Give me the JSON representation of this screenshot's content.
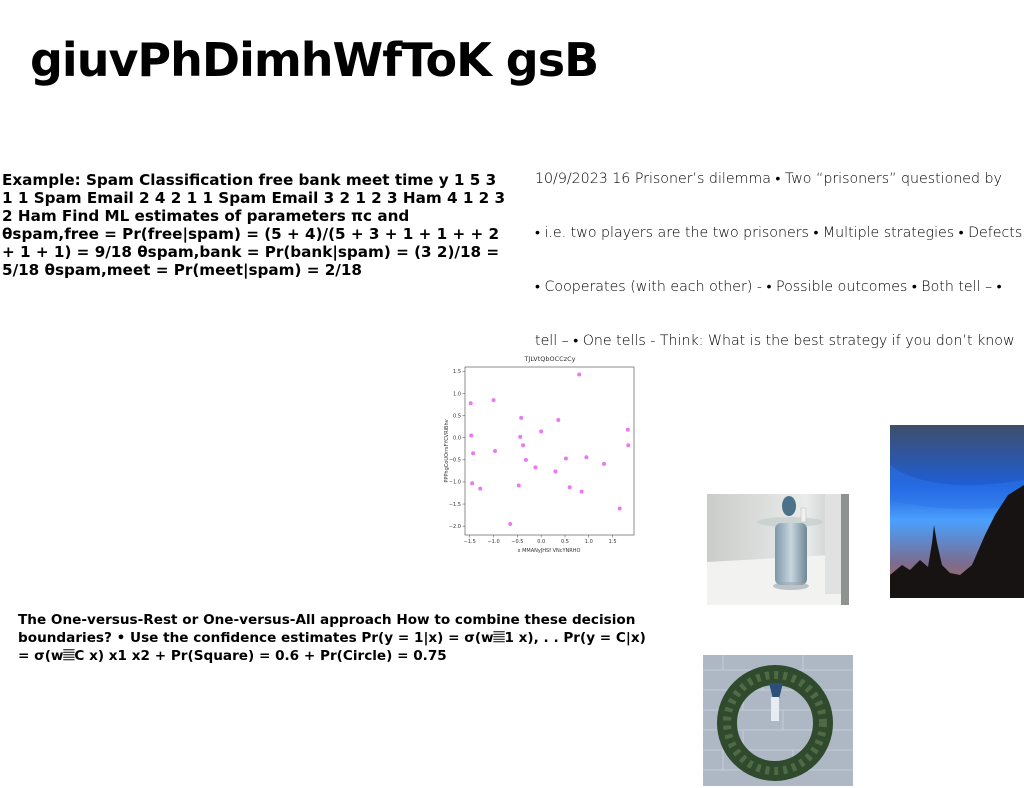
{
  "title": "giuvPhDimhWfToK gsB",
  "spam_text": "Example: Spam Classification free bank meet time y 1 5 3 1 1 Spam Email 2 4 2 1 1 Spam Email 3 2 1 2 3 Ham 4 1 2 3 2 Ham Find ML estimates of parameters πc and θspam,free = Pr(free|spam) = (5 + 4)/(5 + 3 + 1 + 1 + + 2 + 1 + 1) = 9/18 θspam,bank = Pr(bank|spam) = (3 2)/18 = 5/18 θspam,meet = Pr(meet|spam) = 2/18",
  "prisoner_lines": [
    "10/9/2023 16 Prisoner’s dilemma • Two “prisoners” questioned by",
    "• i.e. two players are the two prisoners • Multiple strategies • Defects",
    "• Cooperates (with each other) - • Possible outcomes • Both tell – •",
    "tell – • One tells - Think: What is the best strategy if you don’t know"
  ],
  "ovr_text": "The One-versus-Rest or One-versus-All approach How to combine these decision boundaries? • Use the confidence estimates Pr(y = 1|x) = σ(w𝄚1 x), . . Pr(y = C|x) = σ(w𝄚C x) x1 x2 + Pr(Square) = 0.6 + Pr(Circle) = 0.75",
  "chart_data": {
    "type": "scatter",
    "title": "TJLVtQbOCCzCy",
    "xlabel": "x MMANyJHSf VNcYNRHO",
    "ylabel": "PPPhgCoUOrrsFYCVRIBhv",
    "xlim": [
      -1.6,
      1.95
    ],
    "ylim": [
      -2.2,
      1.6
    ],
    "xticks": [
      -1.5,
      -1.0,
      -0.5,
      0.0,
      0.5,
      1.0,
      1.5
    ],
    "xtick_labels": [
      "−1.5",
      "−1.0",
      "−0.5",
      "0.0",
      "0.5",
      "1.0",
      "1.5"
    ],
    "yticks": [
      1.5,
      1.0,
      0.5,
      0.0,
      -0.5,
      -1.0,
      -1.5,
      -2.0
    ],
    "ytick_labels": [
      "1.5",
      "1.0",
      "0.5",
      "0.0",
      "−0.5",
      "−1.0",
      "−1.5",
      "−2.0"
    ],
    "color": "#e879f0",
    "points": [
      {
        "x": -1.48,
        "y": 0.78
      },
      {
        "x": -1.47,
        "y": 0.05
      },
      {
        "x": -1.43,
        "y": -0.35
      },
      {
        "x": -1.45,
        "y": -1.03
      },
      {
        "x": -1.28,
        "y": -1.15
      },
      {
        "x": -1.0,
        "y": 0.85
      },
      {
        "x": -0.97,
        "y": -0.3
      },
      {
        "x": -0.65,
        "y": -1.95
      },
      {
        "x": -0.47,
        "y": -1.08
      },
      {
        "x": -0.42,
        "y": 0.45
      },
      {
        "x": -0.44,
        "y": 0.02
      },
      {
        "x": -0.38,
        "y": -0.17
      },
      {
        "x": -0.32,
        "y": -0.5
      },
      {
        "x": -0.12,
        "y": -0.67
      },
      {
        "x": 0.0,
        "y": 0.14
      },
      {
        "x": 0.3,
        "y": -0.76
      },
      {
        "x": 0.36,
        "y": 0.4
      },
      {
        "x": 0.52,
        "y": -0.47
      },
      {
        "x": 0.6,
        "y": -1.12
      },
      {
        "x": 0.8,
        "y": 1.43
      },
      {
        "x": 0.85,
        "y": -1.22
      },
      {
        "x": 0.95,
        "y": -0.44
      },
      {
        "x": 1.32,
        "y": -0.59
      },
      {
        "x": 1.65,
        "y": -1.6
      },
      {
        "x": 1.82,
        "y": 0.18
      },
      {
        "x": 1.83,
        "y": -0.17
      }
    ]
  },
  "images": {
    "table_photo": "glass side table photo",
    "sky_photo": "blue sky castle silhouette photo",
    "wreath_photo": "christmas wreath on brick wall photo"
  }
}
